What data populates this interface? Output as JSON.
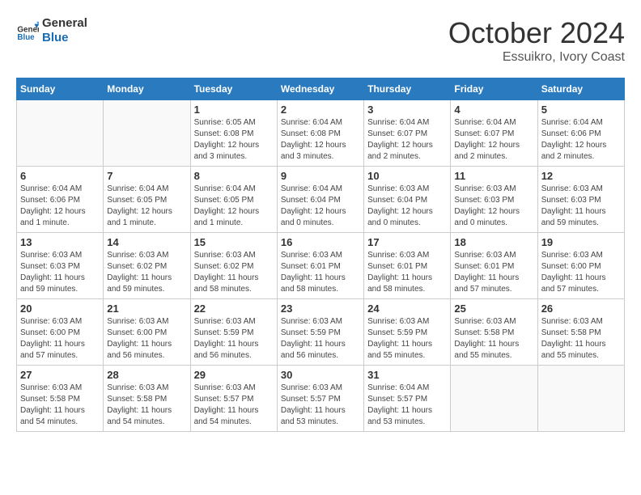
{
  "header": {
    "logo_line1": "General",
    "logo_line2": "Blue",
    "month": "October 2024",
    "location": "Essuikro, Ivory Coast"
  },
  "weekdays": [
    "Sunday",
    "Monday",
    "Tuesday",
    "Wednesday",
    "Thursday",
    "Friday",
    "Saturday"
  ],
  "weeks": [
    [
      {
        "day": "",
        "info": ""
      },
      {
        "day": "",
        "info": ""
      },
      {
        "day": "1",
        "info": "Sunrise: 6:05 AM\nSunset: 6:08 PM\nDaylight: 12 hours and 3 minutes."
      },
      {
        "day": "2",
        "info": "Sunrise: 6:04 AM\nSunset: 6:08 PM\nDaylight: 12 hours and 3 minutes."
      },
      {
        "day": "3",
        "info": "Sunrise: 6:04 AM\nSunset: 6:07 PM\nDaylight: 12 hours and 2 minutes."
      },
      {
        "day": "4",
        "info": "Sunrise: 6:04 AM\nSunset: 6:07 PM\nDaylight: 12 hours and 2 minutes."
      },
      {
        "day": "5",
        "info": "Sunrise: 6:04 AM\nSunset: 6:06 PM\nDaylight: 12 hours and 2 minutes."
      }
    ],
    [
      {
        "day": "6",
        "info": "Sunrise: 6:04 AM\nSunset: 6:06 PM\nDaylight: 12 hours and 1 minute."
      },
      {
        "day": "7",
        "info": "Sunrise: 6:04 AM\nSunset: 6:05 PM\nDaylight: 12 hours and 1 minute."
      },
      {
        "day": "8",
        "info": "Sunrise: 6:04 AM\nSunset: 6:05 PM\nDaylight: 12 hours and 1 minute."
      },
      {
        "day": "9",
        "info": "Sunrise: 6:04 AM\nSunset: 6:04 PM\nDaylight: 12 hours and 0 minutes."
      },
      {
        "day": "10",
        "info": "Sunrise: 6:03 AM\nSunset: 6:04 PM\nDaylight: 12 hours and 0 minutes."
      },
      {
        "day": "11",
        "info": "Sunrise: 6:03 AM\nSunset: 6:03 PM\nDaylight: 12 hours and 0 minutes."
      },
      {
        "day": "12",
        "info": "Sunrise: 6:03 AM\nSunset: 6:03 PM\nDaylight: 11 hours and 59 minutes."
      }
    ],
    [
      {
        "day": "13",
        "info": "Sunrise: 6:03 AM\nSunset: 6:03 PM\nDaylight: 11 hours and 59 minutes."
      },
      {
        "day": "14",
        "info": "Sunrise: 6:03 AM\nSunset: 6:02 PM\nDaylight: 11 hours and 59 minutes."
      },
      {
        "day": "15",
        "info": "Sunrise: 6:03 AM\nSunset: 6:02 PM\nDaylight: 11 hours and 58 minutes."
      },
      {
        "day": "16",
        "info": "Sunrise: 6:03 AM\nSunset: 6:01 PM\nDaylight: 11 hours and 58 minutes."
      },
      {
        "day": "17",
        "info": "Sunrise: 6:03 AM\nSunset: 6:01 PM\nDaylight: 11 hours and 58 minutes."
      },
      {
        "day": "18",
        "info": "Sunrise: 6:03 AM\nSunset: 6:01 PM\nDaylight: 11 hours and 57 minutes."
      },
      {
        "day": "19",
        "info": "Sunrise: 6:03 AM\nSunset: 6:00 PM\nDaylight: 11 hours and 57 minutes."
      }
    ],
    [
      {
        "day": "20",
        "info": "Sunrise: 6:03 AM\nSunset: 6:00 PM\nDaylight: 11 hours and 57 minutes."
      },
      {
        "day": "21",
        "info": "Sunrise: 6:03 AM\nSunset: 6:00 PM\nDaylight: 11 hours and 56 minutes."
      },
      {
        "day": "22",
        "info": "Sunrise: 6:03 AM\nSunset: 5:59 PM\nDaylight: 11 hours and 56 minutes."
      },
      {
        "day": "23",
        "info": "Sunrise: 6:03 AM\nSunset: 5:59 PM\nDaylight: 11 hours and 56 minutes."
      },
      {
        "day": "24",
        "info": "Sunrise: 6:03 AM\nSunset: 5:59 PM\nDaylight: 11 hours and 55 minutes."
      },
      {
        "day": "25",
        "info": "Sunrise: 6:03 AM\nSunset: 5:58 PM\nDaylight: 11 hours and 55 minutes."
      },
      {
        "day": "26",
        "info": "Sunrise: 6:03 AM\nSunset: 5:58 PM\nDaylight: 11 hours and 55 minutes."
      }
    ],
    [
      {
        "day": "27",
        "info": "Sunrise: 6:03 AM\nSunset: 5:58 PM\nDaylight: 11 hours and 54 minutes."
      },
      {
        "day": "28",
        "info": "Sunrise: 6:03 AM\nSunset: 5:58 PM\nDaylight: 11 hours and 54 minutes."
      },
      {
        "day": "29",
        "info": "Sunrise: 6:03 AM\nSunset: 5:57 PM\nDaylight: 11 hours and 54 minutes."
      },
      {
        "day": "30",
        "info": "Sunrise: 6:03 AM\nSunset: 5:57 PM\nDaylight: 11 hours and 53 minutes."
      },
      {
        "day": "31",
        "info": "Sunrise: 6:04 AM\nSunset: 5:57 PM\nDaylight: 11 hours and 53 minutes."
      },
      {
        "day": "",
        "info": ""
      },
      {
        "day": "",
        "info": ""
      }
    ]
  ]
}
